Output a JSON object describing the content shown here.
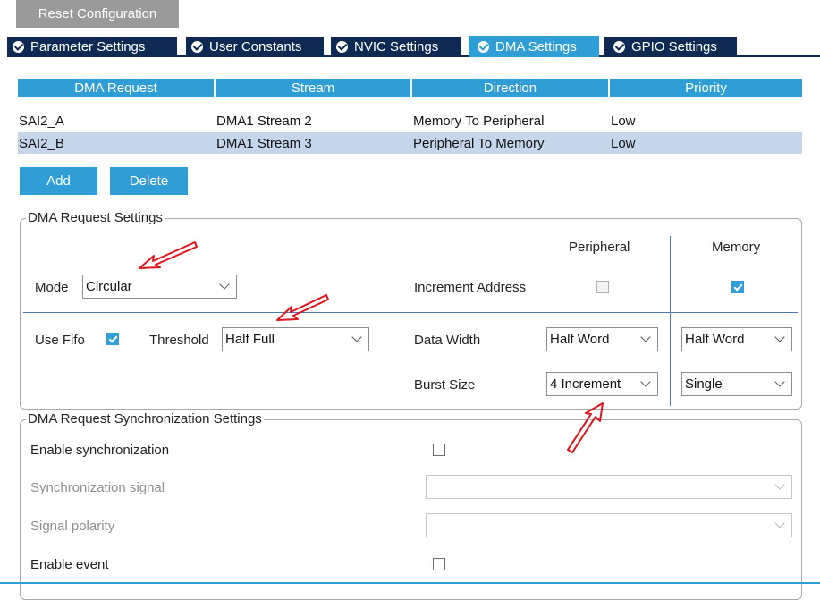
{
  "toolbar": {
    "reset_label": "Reset Configuration"
  },
  "tabs": [
    {
      "label": "Parameter Settings",
      "active": false
    },
    {
      "label": "User Constants",
      "active": false
    },
    {
      "label": "NVIC Settings",
      "active": false
    },
    {
      "label": "DMA Settings",
      "active": true
    },
    {
      "label": "GPIO Settings",
      "active": false
    }
  ],
  "dma_table": {
    "headers": [
      "DMA Request",
      "Stream",
      "Direction",
      "Priority"
    ],
    "rows": [
      [
        "SAI2_A",
        "DMA1 Stream 2",
        "Memory To Peripheral",
        "Low"
      ],
      [
        "SAI2_B",
        "DMA1 Stream 3",
        "Peripheral To Memory",
        "Low"
      ]
    ],
    "selected_row": 1
  },
  "actions": {
    "add_label": "Add",
    "delete_label": "Delete"
  },
  "request_settings": {
    "legend": "DMA Request Settings",
    "peripheral_header": "Peripheral",
    "memory_header": "Memory",
    "mode_label": "Mode",
    "mode_value": "Circular",
    "increment_address_label": "Increment Address",
    "use_fifo_label": "Use Fifo",
    "threshold_label": "Threshold",
    "threshold_value": "Half Full",
    "data_width_label": "Data Width",
    "peripheral_data_width": "Half Word",
    "memory_data_width": "Half Word",
    "burst_size_label": "Burst Size",
    "peripheral_burst_size": "4 Increment",
    "memory_burst_size": "Single"
  },
  "sync_settings": {
    "legend": "DMA Request Synchronization Settings",
    "enable_sync_label": "Enable synchronization",
    "sync_signal_label": "Synchronization signal",
    "signal_polarity_label": "Signal polarity",
    "enable_event_label": "Enable event"
  },
  "colors": {
    "accent": "#2f9ed6",
    "tab_dark": "#0e2a52",
    "selected_row": "#c5d5ea",
    "annotation": "#e0141b"
  }
}
